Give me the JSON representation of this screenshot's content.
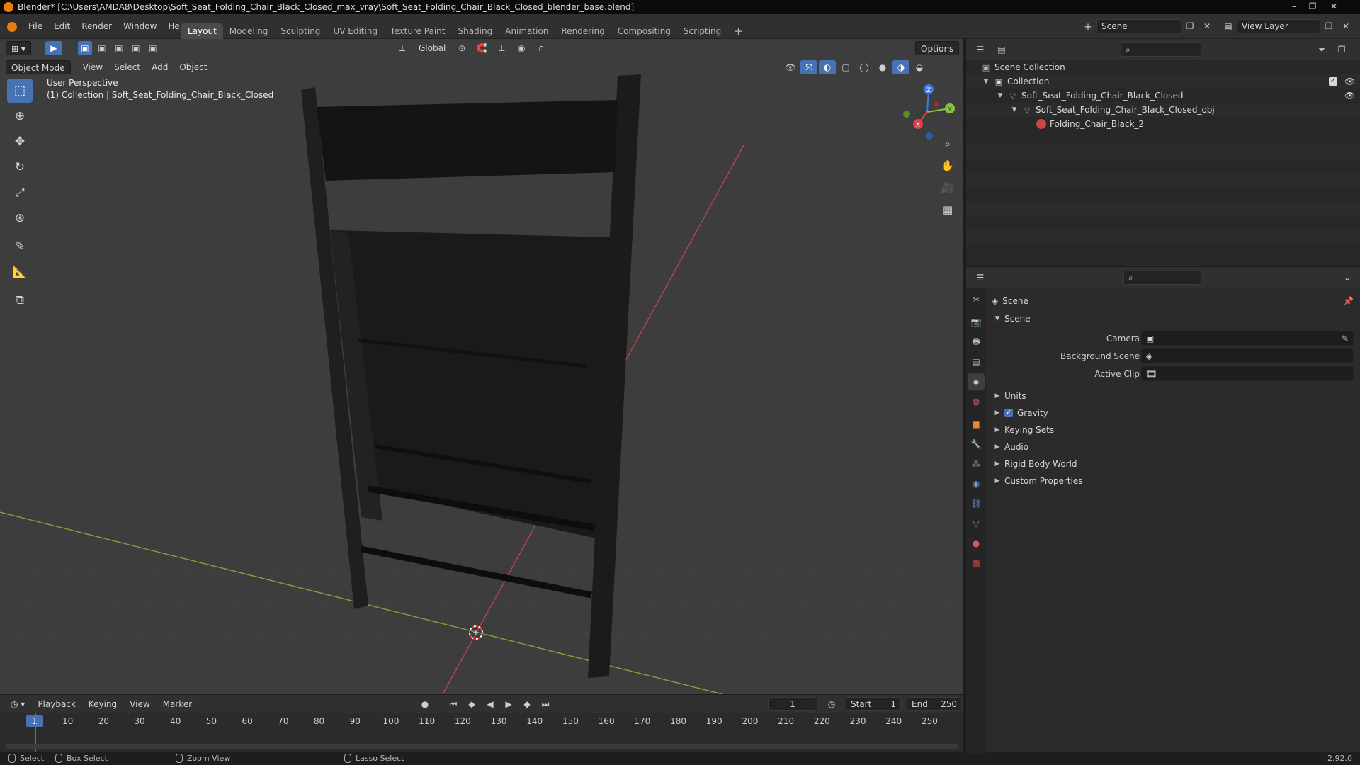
{
  "window": {
    "title": "Blender* [C:\\Users\\AMDA8\\Desktop\\Soft_Seat_Folding_Chair_Black_Closed_max_vray\\Soft_Seat_Folding_Chair_Black_Closed_blender_base.blend]",
    "controls": [
      "–",
      "❐",
      "✕"
    ]
  },
  "menubar": {
    "items": [
      "File",
      "Edit",
      "Render",
      "Window",
      "Help"
    ]
  },
  "workspaces": {
    "tabs": [
      "Layout",
      "Modeling",
      "Sculpting",
      "UV Editing",
      "Texture Paint",
      "Shading",
      "Animation",
      "Rendering",
      "Compositing",
      "Scripting"
    ],
    "active": "Layout",
    "add": "+"
  },
  "scene_selector": {
    "value": "Scene"
  },
  "view_layer_selector": {
    "value": "View Layer"
  },
  "viewport": {
    "mode": "Object Mode",
    "menus": [
      "View",
      "Select",
      "Add",
      "Object"
    ],
    "orientation": "Global",
    "options_label": "Options",
    "overlay_line1": "User Perspective",
    "overlay_line2": "(1) Collection | Soft_Seat_Folding_Chair_Black_Closed",
    "gizmo": {
      "x": "X",
      "y": "Y",
      "z": "Z"
    }
  },
  "timeline": {
    "menus": [
      "Playback",
      "Keying",
      "View",
      "Marker"
    ],
    "current_frame": "1",
    "start_label": "Start",
    "start_value": "1",
    "end_label": "End",
    "end_value": "250",
    "ticks": [
      "1",
      "10",
      "20",
      "30",
      "40",
      "50",
      "60",
      "70",
      "80",
      "90",
      "100",
      "110",
      "120",
      "130",
      "140",
      "150",
      "160",
      "170",
      "180",
      "190",
      "200",
      "210",
      "220",
      "230",
      "240",
      "250"
    ]
  },
  "statusbar": {
    "select": "Select",
    "box_select": "Box Select",
    "zoom_view": "Zoom View",
    "lasso_select": "Lasso Select",
    "version": "2.92.0"
  },
  "outliner": {
    "rows": [
      {
        "label": "Scene Collection"
      },
      {
        "label": "Collection"
      },
      {
        "label": "Soft_Seat_Folding_Chair_Black_Closed"
      },
      {
        "label": "Soft_Seat_Folding_Chair_Black_Closed_obj"
      },
      {
        "label": "Folding_Chair_Black_2"
      }
    ]
  },
  "properties": {
    "context": "Scene",
    "panel_title": "Scene",
    "fields": [
      {
        "label": "Camera",
        "value": ""
      },
      {
        "label": "Background Scene",
        "value": ""
      },
      {
        "label": "Active Clip",
        "value": ""
      }
    ],
    "subpanels": [
      "Units",
      "Gravity",
      "Keying Sets",
      "Audio",
      "Rigid Body World",
      "Custom Properties"
    ]
  },
  "colors": {
    "accent": "#4772b3",
    "x_axis": "#e33e4e",
    "y_axis": "#8bc53f",
    "z_axis": "#3d7bd9",
    "blender_orange": "#e87d0d"
  }
}
